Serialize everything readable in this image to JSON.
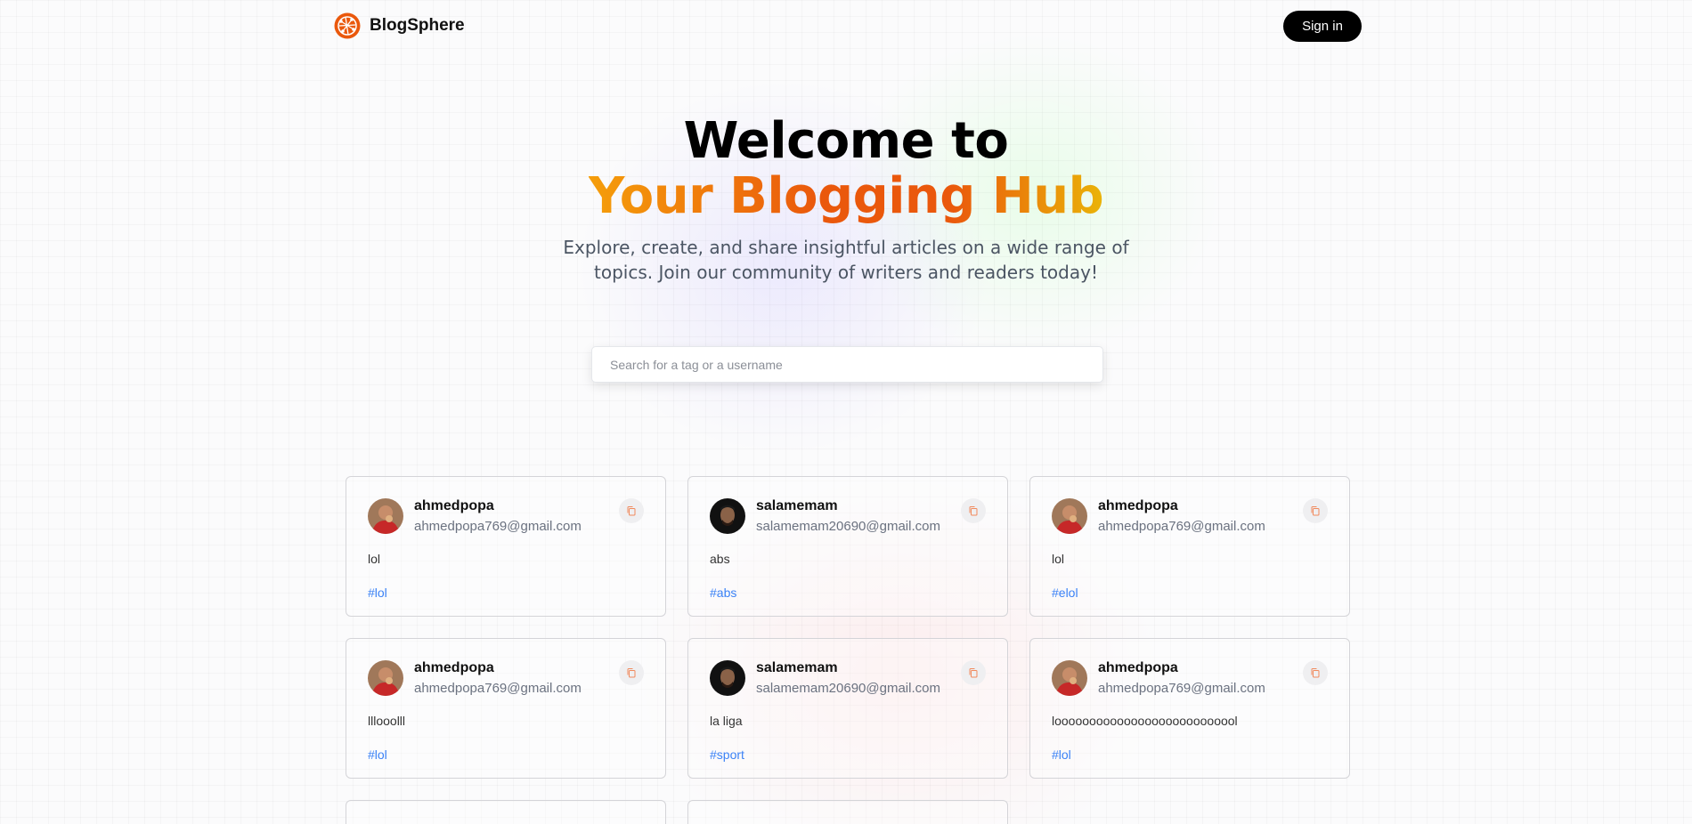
{
  "header": {
    "brand_name": "BlogSphere",
    "brand_icon": "globe-network-icon",
    "signin_label": "Sign in"
  },
  "hero": {
    "line1": "Welcome to",
    "line2": "Your Blogging Hub",
    "subtitle": "Explore, create, and share insightful articles on a wide range of topics. Join our community of writers and readers today!"
  },
  "search": {
    "placeholder": "Search for a tag or a username",
    "value": ""
  },
  "colors": {
    "brand_accent": "#ea580c",
    "tag_link": "#3b82f6",
    "gradient_start": "#f59e0b",
    "gradient_end": "#eab308"
  },
  "cards": [
    {
      "username": "ahmedpopa",
      "email": "ahmedpopa769@gmail.com",
      "text": "lol",
      "tag": "#lol",
      "avatar": "red-shirt-avatar"
    },
    {
      "username": "salamemam",
      "email": "salamemam20690@gmail.com",
      "text": "abs",
      "tag": "#abs",
      "avatar": "dark-portrait-avatar"
    },
    {
      "username": "ahmedpopa",
      "email": "ahmedpopa769@gmail.com",
      "text": "lol",
      "tag": "#elol",
      "avatar": "red-shirt-avatar"
    },
    {
      "username": "ahmedpopa",
      "email": "ahmedpopa769@gmail.com",
      "text": "lllooolll",
      "tag": "#lol",
      "avatar": "red-shirt-avatar"
    },
    {
      "username": "salamemam",
      "email": "salamemam20690@gmail.com",
      "text": "la liga",
      "tag": "#sport",
      "avatar": "dark-portrait-avatar"
    },
    {
      "username": "ahmedpopa",
      "email": "ahmedpopa769@gmail.com",
      "text": "looooooooooooooooooooooooool",
      "tag": "#lol",
      "avatar": "red-shirt-avatar"
    }
  ]
}
